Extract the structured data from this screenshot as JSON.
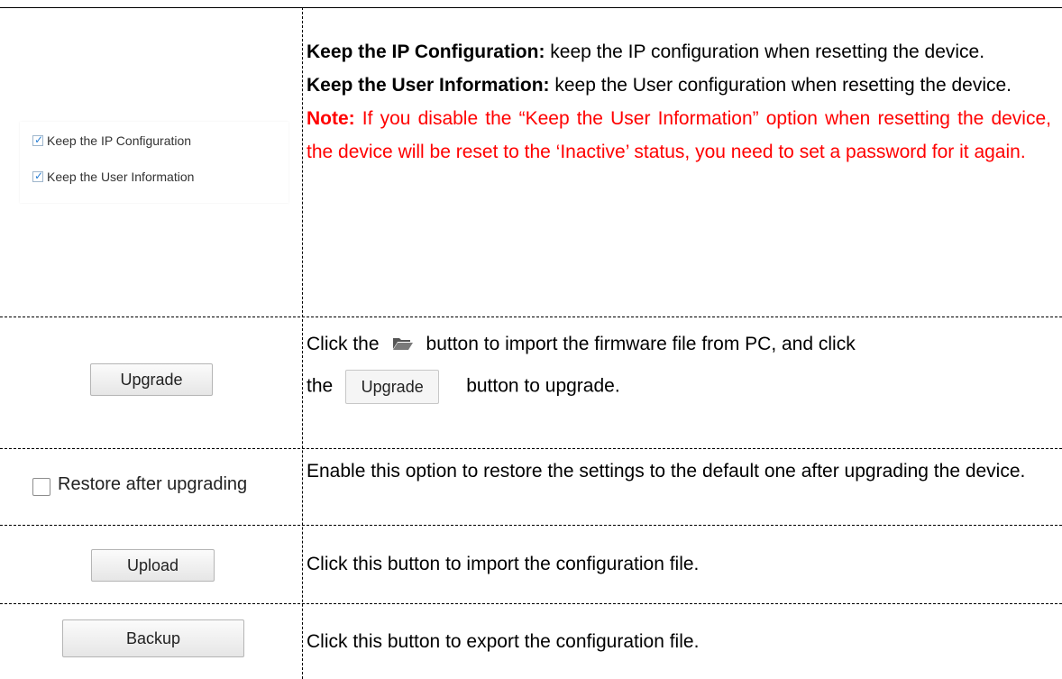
{
  "rows": [
    {
      "checkboxes": [
        {
          "label": "Keep the IP Configuration",
          "checked": true
        },
        {
          "label": "Keep the User Information",
          "checked": true
        }
      ],
      "desc": {
        "ip_title": "Keep the IP Configuration:",
        "ip_text": " keep the IP configuration when resetting the device.",
        "user_title": "Keep the User Information:",
        "user_text": " keep the User configuration when resetting the device.",
        "note_title": "Note:",
        "note_text": " If you disable the “Keep the User Information” option when resetting the device, the device will be reset to the ‘Inactive’ status, you need to set a password for it again."
      }
    },
    {
      "button_label": "Upgrade",
      "desc": {
        "part1": "Click the",
        "icon": "folder-open-icon",
        "part2": "button to import the firmware file from PC, and click",
        "part3": "the",
        "inline_button": "Upgrade",
        "part4": "button to upgrade."
      }
    },
    {
      "checkbox_label": "Restore after upgrading",
      "checked": false,
      "desc": "Enable this option to restore the settings to the default one after upgrading the device."
    },
    {
      "button_label": "Upload",
      "desc": "Click this button to import the configuration file."
    },
    {
      "button_label": "Backup",
      "desc": "Click this button to export the configuration file."
    }
  ],
  "colors": {
    "note": "#ff0000",
    "check": "#2a7fd4"
  }
}
